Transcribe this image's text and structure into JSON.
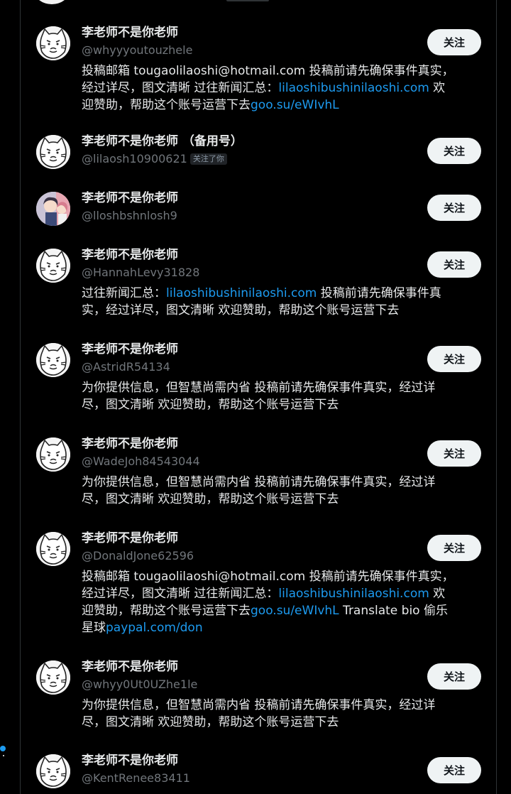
{
  "follow_label": "关注",
  "follows_you_label": "关注了你",
  "users": [
    {
      "name": "李老师不是你老师",
      "handle": "@whyyyoutouzhele",
      "follows_you": false,
      "avatar": "cat-doodle",
      "bio": [
        {
          "t": "投稿邮箱 tougaolilaoshi@hotmail.com 投稿前请先确保事件真实，\n经过详尽，图文清晰 过往新闻汇总："
        },
        {
          "t": "lilaoshibushinilaoshi.com",
          "link": true
        },
        {
          "t": " 欢\n迎赞助，帮助这个账号运营下去"
        },
        {
          "t": "goo.su/eWIvhL",
          "link": true
        }
      ]
    },
    {
      "name": "李老师不是你老师 （备用号）",
      "handle": "@lilaosh10900621",
      "follows_you": true,
      "avatar": "cat-doodle",
      "bio": []
    },
    {
      "name": "李老师不是你老师",
      "handle": "@lloshbshnlosh9",
      "follows_you": false,
      "avatar": "anime-photo",
      "bio": []
    },
    {
      "name": "李老师不是你老师",
      "handle": "@HannahLevy31828",
      "follows_you": false,
      "avatar": "cat-doodle",
      "bio": [
        {
          "t": "过往新闻汇总："
        },
        {
          "t": "lilaoshibushinilaoshi.com",
          "link": true
        },
        {
          "t": " 投稿前请先确保事件真\n实，经过详尽，图文清晰 欢迎赞助，帮助这个账号运营下去"
        }
      ]
    },
    {
      "name": "李老师不是你老师",
      "handle": "@AstridR54134",
      "follows_you": false,
      "avatar": "cat-doodle",
      "bio": [
        {
          "t": "为你提供信息，但智慧尚需内省 投稿前请先确保事件真实，经过详\n尽，图文清晰 欢迎赞助，帮助这个账号运营下去"
        }
      ]
    },
    {
      "name": "李老师不是你老师",
      "handle": "@WadeJoh84543044",
      "follows_you": false,
      "avatar": "cat-doodle",
      "bio": [
        {
          "t": "为你提供信息，但智慧尚需内省 投稿前请先确保事件真实，经过详\n尽，图文清晰 欢迎赞助，帮助这个账号运营下去"
        }
      ]
    },
    {
      "name": "李老师不是你老师",
      "handle": "@DonaldJone62596",
      "follows_you": false,
      "avatar": "cat-doodle",
      "bio": [
        {
          "t": "投稿邮箱 tougaolilaoshi@hotmail.com 投稿前请先确保事件真实，\n经过详尽，图文清晰 过往新闻汇总："
        },
        {
          "t": "lilaoshibushinilaoshi.com",
          "link": true
        },
        {
          "t": " 欢\n迎赞助，帮助这个账号运营下去"
        },
        {
          "t": "goo.su/eWIvhL",
          "link": true
        },
        {
          "t": " Translate bio 偷乐\n星球"
        },
        {
          "t": "paypal.com/don",
          "link": true
        }
      ]
    },
    {
      "name": "李老师不是你老师",
      "handle": "@whyy0Ut0UZhe1le",
      "follows_you": false,
      "avatar": "cat-doodle",
      "bio": [
        {
          "t": "为你提供信息，但智慧尚需内省 投稿前请先确保事件真实，经过详\n尽，图文清晰 欢迎赞助，帮助这个账号运营下去"
        }
      ]
    },
    {
      "name": "李老师不是你老师",
      "handle": "@KentRenee83411",
      "follows_you": false,
      "avatar": "cat-doodle",
      "bio": []
    }
  ]
}
